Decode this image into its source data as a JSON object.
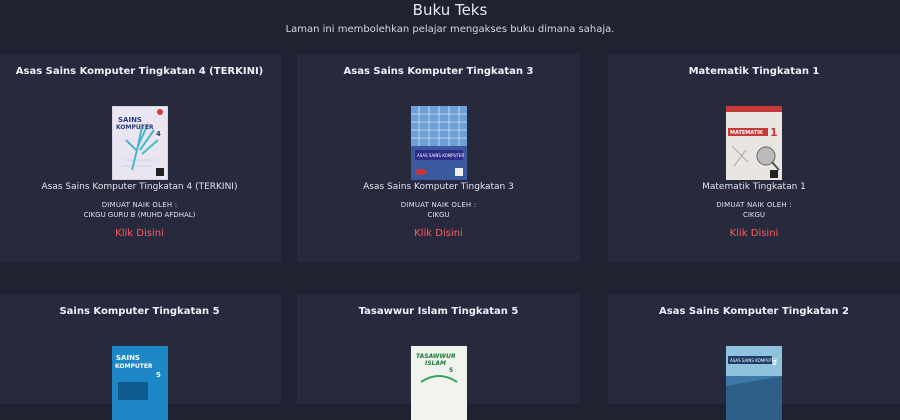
{
  "header": {
    "title": "Buku Teks",
    "subtitle": "Laman ini membolehkan pelajar mengakses buku dimana sahaja."
  },
  "cards": [
    {
      "title": "Asas Sains Komputer Tingkatan 4 (TERKINI)",
      "caption": "Asas Sains Komputer Tingkatan 4 (TERKINI)",
      "uploader_label": "DIMUAT NAIK OLEH :",
      "uploader_name": "CIKGU GURU B (MUHD AFDHAL)",
      "link": "Klik Disini",
      "cover_text": [
        "SAINS",
        "KOMPUTER",
        "4"
      ],
      "cover_color": "#e9e6f2"
    },
    {
      "title": "Asas Sains Komputer Tingkatan 3",
      "caption": "Asas Sains Komputer Tingkatan 3",
      "uploader_label": "DIMUAT NAIK OLEH :",
      "uploader_name": "CIKGU",
      "link": "Klik Disini",
      "cover_text": [
        "ASAS SAINS KOMPUTER"
      ],
      "cover_color": "#3a5aa0"
    },
    {
      "title": "Matematik Tingkatan 1",
      "caption": "Matematik Tingkatan 1",
      "uploader_label": "DIMUAT NAIK OLEH :",
      "uploader_name": "CIKGU",
      "link": "Klik Disini",
      "cover_text": [
        "MATEMATIK",
        "1"
      ],
      "cover_color": "#e9e6e1"
    },
    {
      "title": "Sains Komputer Tingkatan 5",
      "cover_text": [
        "SAINS",
        "KOMPUTER",
        "5"
      ],
      "cover_color": "#1e88c6"
    },
    {
      "title": "Tasawwur Islam Tingkatan 5",
      "cover_text": [
        "TASAWWUR",
        "ISLAM",
        "5"
      ],
      "cover_color": "#f1f4ee"
    },
    {
      "title": "Asas Sains Komputer Tingkatan 2",
      "cover_text": [
        "ASAS SAINS KOMPUTER",
        "2"
      ],
      "cover_color": "#3c78a8"
    }
  ],
  "colors": {
    "background": "#1f2231",
    "card": "#262a3c",
    "link": "#ff5a5f"
  }
}
